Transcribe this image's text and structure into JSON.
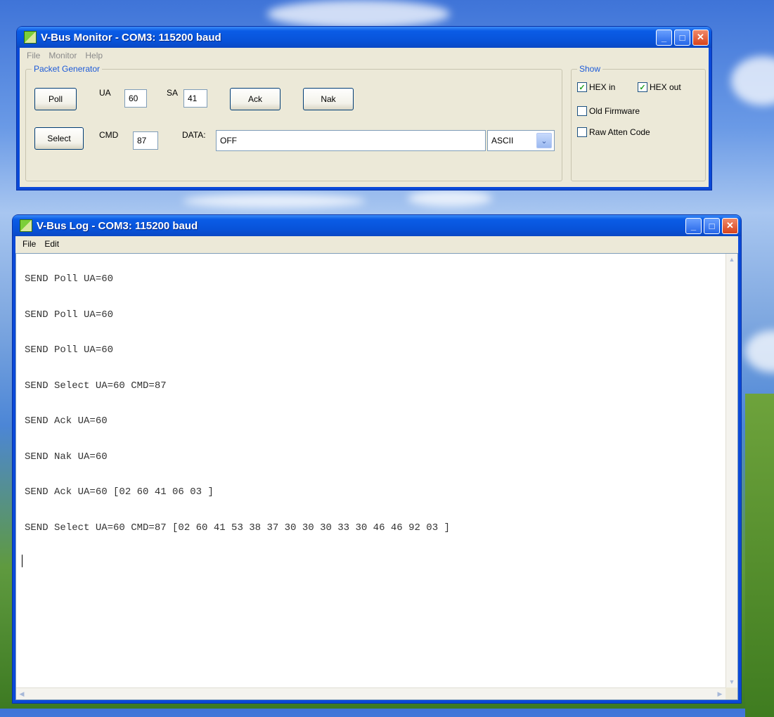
{
  "monitor": {
    "title": "V-Bus Monitor - COM3: 115200 baud",
    "menu": [
      "File",
      "Monitor",
      "Help"
    ],
    "packet_generator": {
      "legend": "Packet Generator",
      "poll_button": "Poll",
      "select_button": "Select",
      "ack_button": "Ack",
      "nak_button": "Nak",
      "ua_label": "UA",
      "ua_value": "60",
      "sa_label": "SA",
      "sa_value": "41",
      "cmd_label": "CMD",
      "cmd_value": "87",
      "data_label": "DATA:",
      "data_value": "OFF",
      "encoding_selected": "ASCII"
    },
    "show": {
      "legend": "Show",
      "hex_in": {
        "label": "HEX in",
        "checked": true
      },
      "hex_out": {
        "label": "HEX out",
        "checked": true
      },
      "old_firmware": {
        "label": "Old Firmware",
        "checked": false
      },
      "raw_atten_code": {
        "label": "Raw Atten Code",
        "checked": false
      }
    }
  },
  "log": {
    "title": "V-Bus Log - COM3: 115200 baud",
    "menu": [
      "File",
      "Edit"
    ],
    "lines": [
      "SEND Poll UA=60",
      "SEND Poll UA=60",
      "SEND Poll UA=60",
      "SEND Select UA=60 CMD=87",
      "SEND Ack UA=60",
      "SEND Nak UA=60",
      "SEND Ack UA=60 [02 60 41 06 03 ]",
      "SEND Select UA=60 CMD=87 [02 60 41 53 38 37 30 30 30 33 30 46 46 92 03 ]"
    ]
  },
  "colors": {
    "xp_blue": "#0a49d8",
    "window_face": "#ece9d8",
    "group_legend": "#1c5ad8",
    "check_mark": "#21a121"
  },
  "icons": [
    "app-icon",
    "minimize-icon",
    "maximize-icon",
    "close-icon",
    "chevron-down-icon",
    "checkmark-icon",
    "scroll-up-arrow-icon",
    "scroll-down-arrow-icon",
    "scroll-left-arrow-icon",
    "scroll-right-arrow-icon"
  ]
}
